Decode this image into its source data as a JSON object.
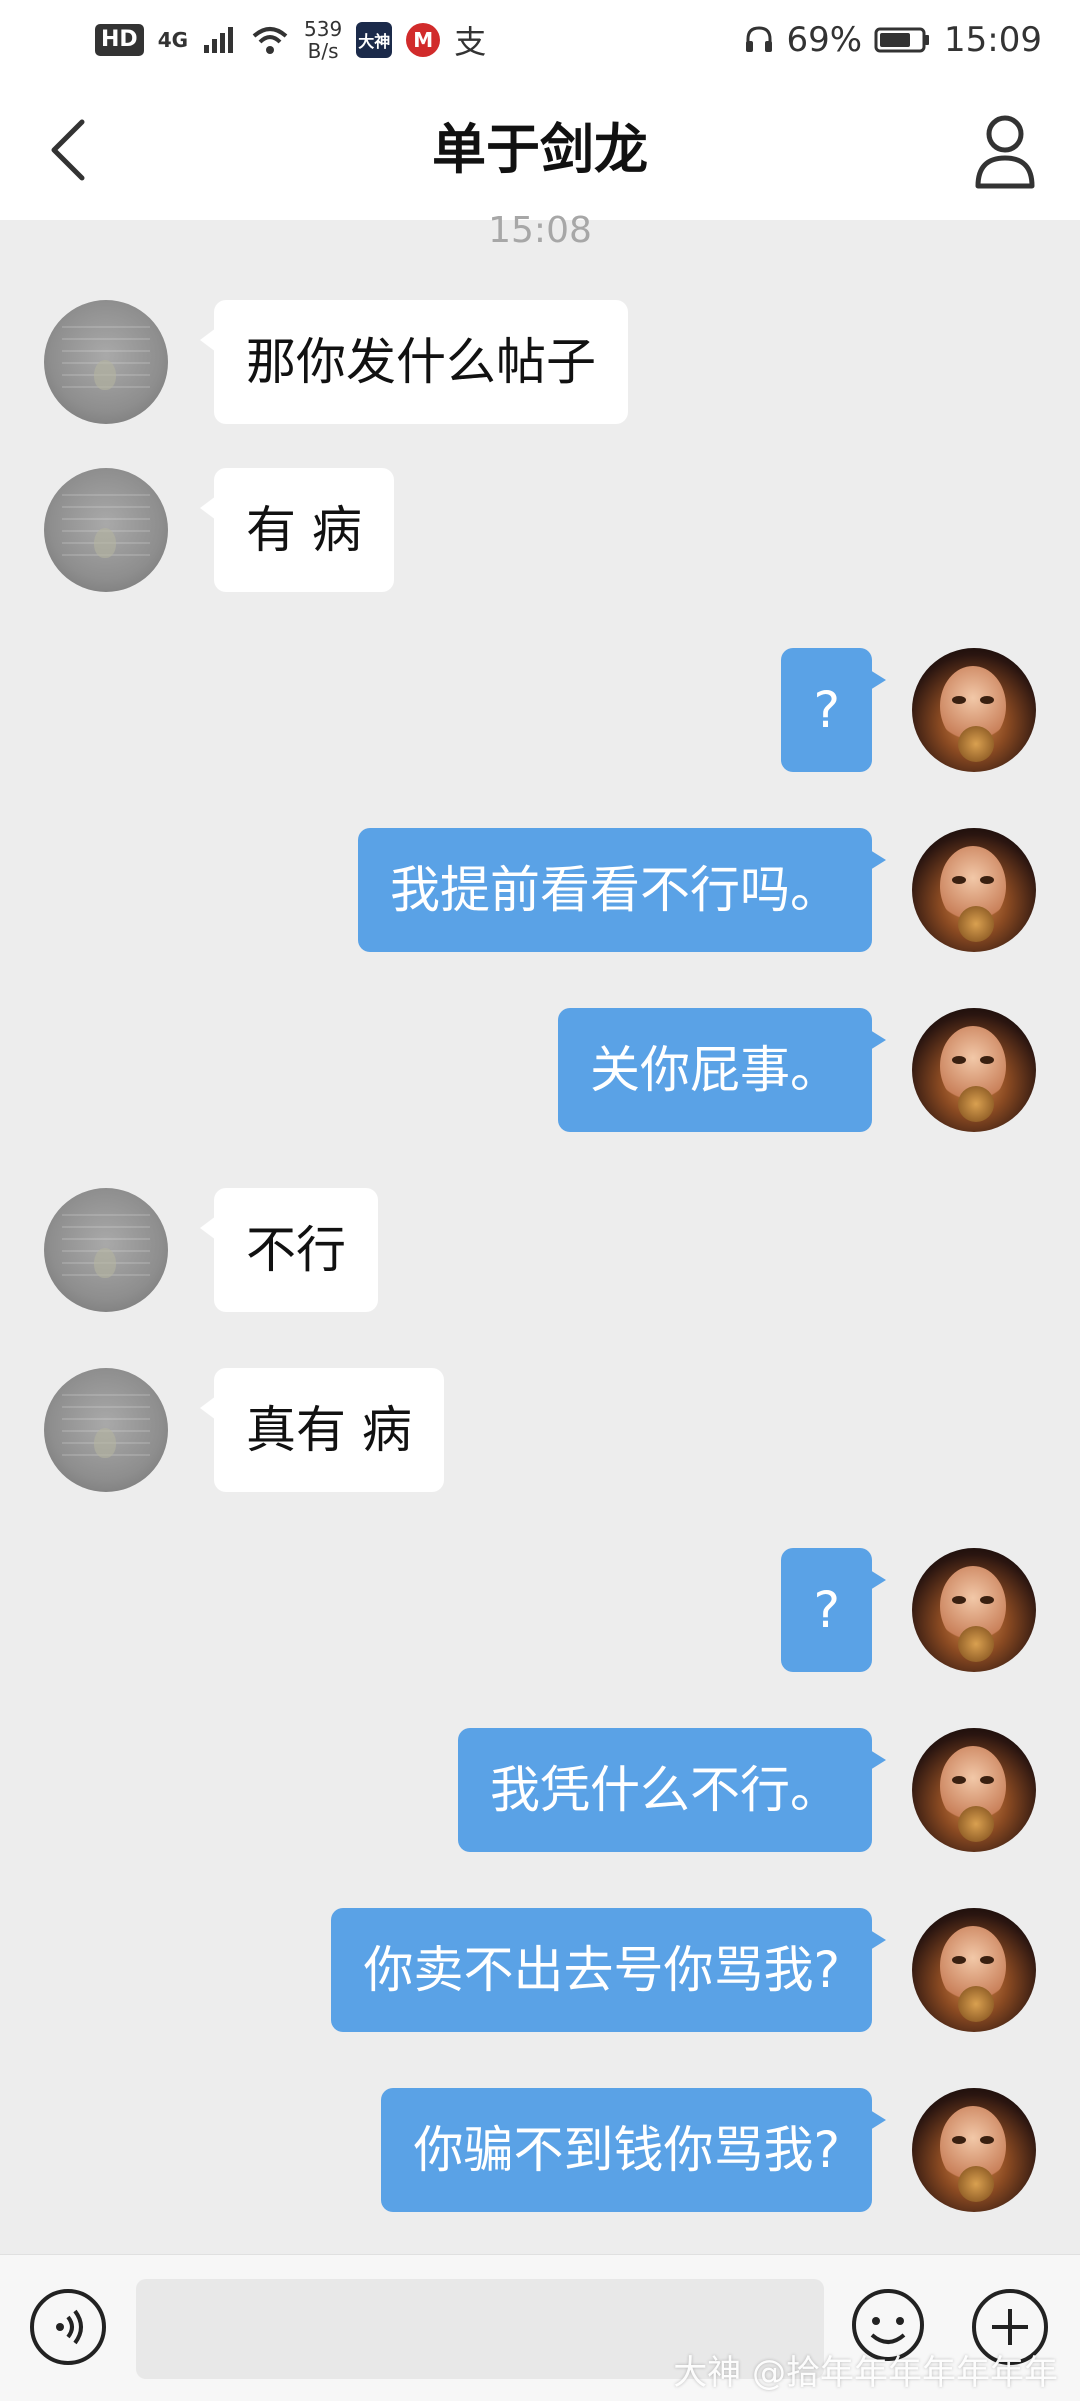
{
  "status_bar": {
    "hd": "HD",
    "network": "4G",
    "speed_value": "539",
    "speed_unit": "B/s",
    "app_badge": "大神",
    "battery": "69%",
    "time": "15:09"
  },
  "header": {
    "title": "单于剑龙"
  },
  "timestamp": "15:08",
  "messages": [
    {
      "side": "left",
      "text": "那你发什么帖子"
    },
    {
      "side": "left",
      "text": "有 病"
    },
    {
      "side": "right",
      "text": "?"
    },
    {
      "side": "right",
      "text": "我提前看看不行吗。"
    },
    {
      "side": "right",
      "text": "关你屁事。"
    },
    {
      "side": "left",
      "text": "不行"
    },
    {
      "side": "left",
      "text": "真有 病"
    },
    {
      "side": "right",
      "text": "?"
    },
    {
      "side": "right",
      "text": "我凭什么不行。"
    },
    {
      "side": "right",
      "text": "你卖不出去号你骂我?"
    },
    {
      "side": "right",
      "text": "你骗不到钱你骂我?"
    }
  ],
  "input": {
    "placeholder": ""
  },
  "watermark": "大神 @拾年年年年年年年",
  "colors": {
    "sent_bubble": "#5aa2e6",
    "received_bubble": "#ffffff",
    "background": "#ededed"
  }
}
